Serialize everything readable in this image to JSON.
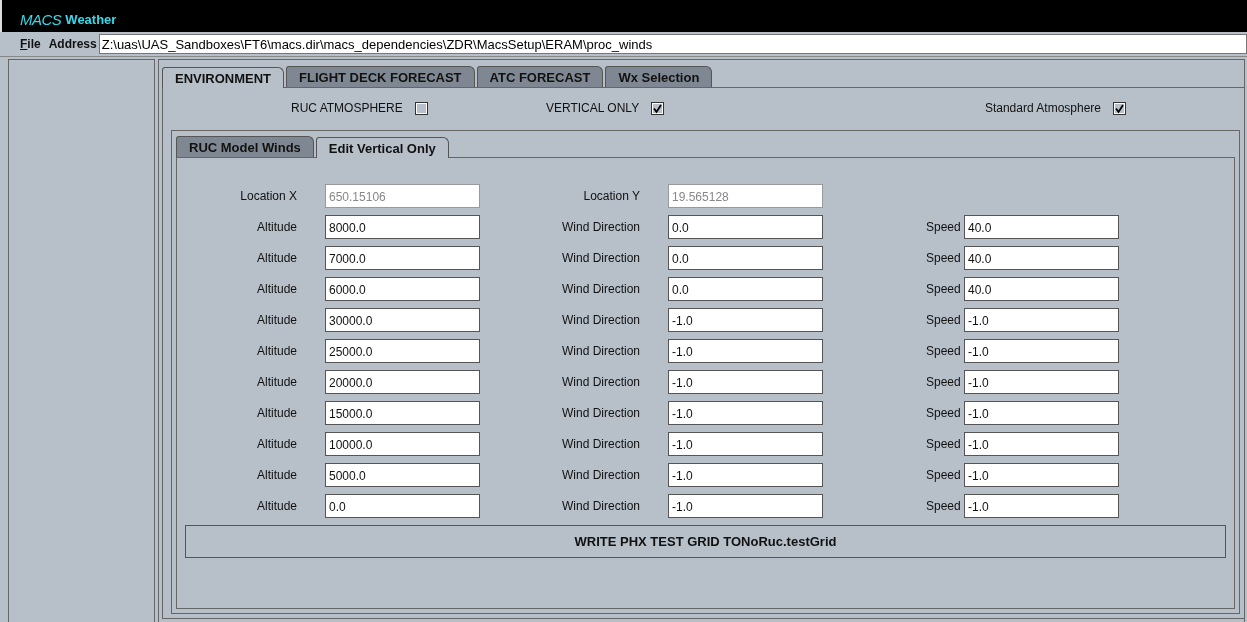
{
  "window": {
    "logo": "MACS",
    "title": "Weather"
  },
  "menu": [
    {
      "label": "File",
      "kind": "menu"
    },
    {
      "label": "Address",
      "kind": "label"
    }
  ],
  "address": {
    "value": "Z:\\uas\\UAS_Sandboxes\\FT6\\macs.dir\\macs_dependencies\\ZDR\\MacsSetup\\ERAM\\proc_winds"
  },
  "tabs": [
    {
      "label": "ENVIRONMENT",
      "selected": true
    },
    {
      "label": "FLIGHT DECK FORECAST",
      "selected": false
    },
    {
      "label": "ATC FORECAST",
      "selected": false
    },
    {
      "label": "Wx Selection",
      "selected": false
    }
  ],
  "options": [
    {
      "label": "RUC ATMOSPHERE",
      "checked": false
    },
    {
      "label": "VERTICAL ONLY",
      "checked": true
    },
    {
      "label": "Standard Atmosphere",
      "checked": true
    }
  ],
  "subtabs": [
    {
      "label": "RUC Model Winds",
      "selected": false
    },
    {
      "label": "Edit Vertical Only",
      "selected": true
    }
  ],
  "location": [
    {
      "label": "Location X",
      "value": "650.15106",
      "disabled": true
    },
    {
      "label": "Location Y",
      "value": "19.565128",
      "disabled": true
    }
  ],
  "rows": [
    {
      "altitude_label": "Altitude",
      "altitude": "8000.0",
      "direction_label": "Wind Direction",
      "direction": "0.0",
      "speed_label": "Speed",
      "speed": "40.0"
    },
    {
      "altitude_label": "Altitude",
      "altitude": "7000.0",
      "direction_label": "Wind Direction",
      "direction": "0.0",
      "speed_label": "Speed",
      "speed": "40.0"
    },
    {
      "altitude_label": "Altitude",
      "altitude": "6000.0",
      "direction_label": "Wind Direction",
      "direction": "0.0",
      "speed_label": "Speed",
      "speed": "40.0"
    },
    {
      "altitude_label": "Altitude",
      "altitude": "30000.0",
      "direction_label": "Wind Direction",
      "direction": "-1.0",
      "speed_label": "Speed",
      "speed": "-1.0"
    },
    {
      "altitude_label": "Altitude",
      "altitude": "25000.0",
      "direction_label": "Wind Direction",
      "direction": "-1.0",
      "speed_label": "Speed",
      "speed": "-1.0"
    },
    {
      "altitude_label": "Altitude",
      "altitude": "20000.0",
      "direction_label": "Wind Direction",
      "direction": "-1.0",
      "speed_label": "Speed",
      "speed": "-1.0"
    },
    {
      "altitude_label": "Altitude",
      "altitude": "15000.0",
      "direction_label": "Wind Direction",
      "direction": "-1.0",
      "speed_label": "Speed",
      "speed": "-1.0"
    },
    {
      "altitude_label": "Altitude",
      "altitude": "10000.0",
      "direction_label": "Wind Direction",
      "direction": "-1.0",
      "speed_label": "Speed",
      "speed": "-1.0"
    },
    {
      "altitude_label": "Altitude",
      "altitude": "5000.0",
      "direction_label": "Wind Direction",
      "direction": "-1.0",
      "speed_label": "Speed",
      "speed": "-1.0"
    },
    {
      "altitude_label": "Altitude",
      "altitude": "0.0",
      "direction_label": "Wind Direction",
      "direction": "-1.0",
      "speed_label": "Speed",
      "speed": "-1.0"
    }
  ],
  "write_button": "WRITE PHX TEST GRID TONoRuc.testGrid"
}
